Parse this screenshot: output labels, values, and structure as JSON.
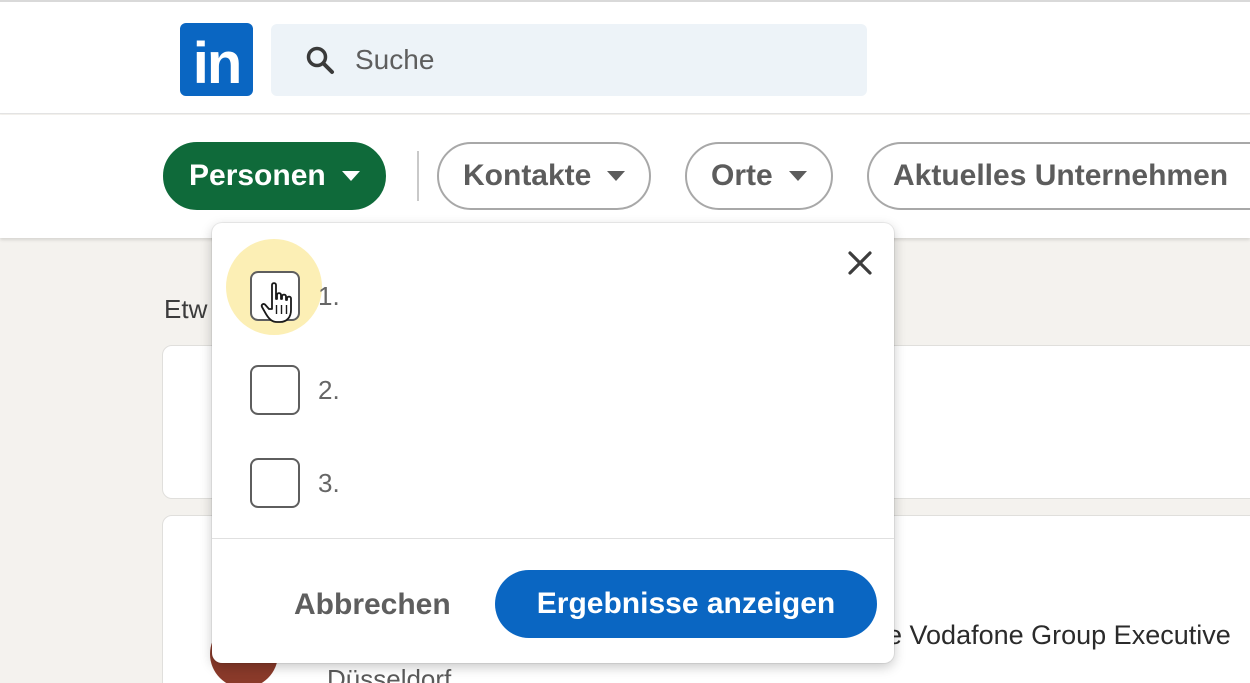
{
  "header": {
    "logo_text": "in",
    "search": {
      "placeholder": "Suche"
    }
  },
  "filters": [
    {
      "label": "Personen",
      "active": true
    },
    {
      "label": "Kontakte",
      "active": false
    },
    {
      "label": "Orte",
      "active": false
    },
    {
      "label": "Aktuelles Unternehmen",
      "active": false
    }
  ],
  "background": {
    "heading_partial": "Etw",
    "snippet_partial": "e Vodafone Group Executive",
    "location_partial": "Düsseldorf"
  },
  "dropdown": {
    "options": [
      {
        "label": "1.",
        "checked": false
      },
      {
        "label": "2.",
        "checked": false
      },
      {
        "label": "3.",
        "checked": false
      }
    ],
    "cancel_label": "Abbrechen",
    "apply_label": "Ergebnisse anzeigen"
  },
  "colors": {
    "brand_blue": "#0a66c2",
    "active_filter_green": "#0f6a3a",
    "search_bg": "#edf3f8"
  }
}
